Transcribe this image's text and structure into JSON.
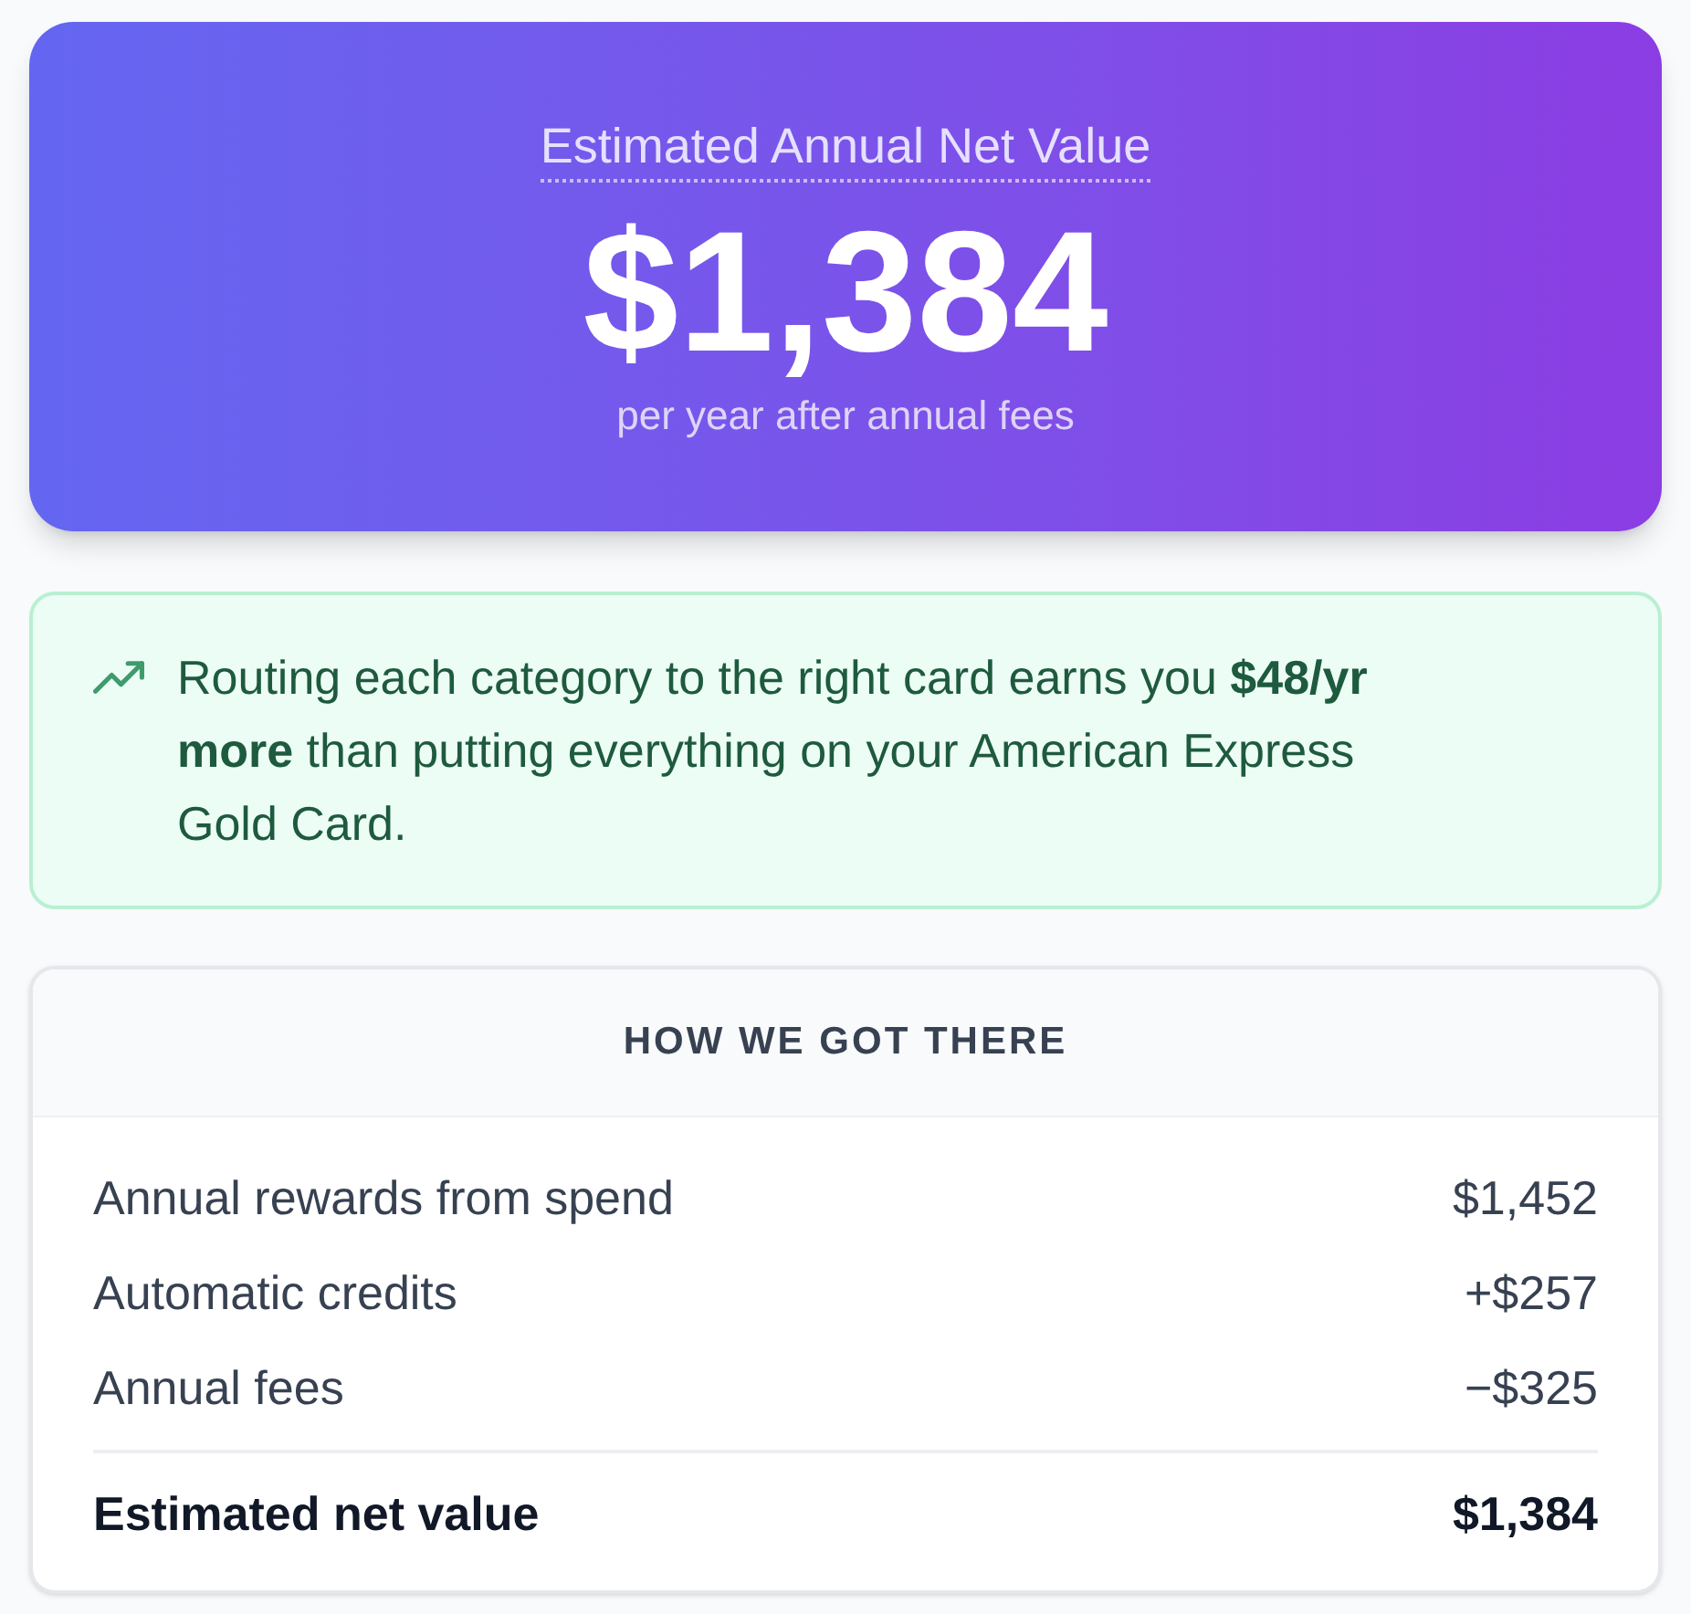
{
  "hero": {
    "title": "Estimated Annual Net Value",
    "value": "$1,384",
    "caption": "per year after annual fees"
  },
  "callout": {
    "text": "Routing each category to the right card earns you **$48/yr more** than putting everything on your American Express Gold Card."
  },
  "breakdown": {
    "title": "HOW WE GOT THERE",
    "rows": [
      {
        "label": "Annual rewards from spend",
        "value": "$1,452"
      },
      {
        "label": "Automatic credits",
        "value": "+$257"
      },
      {
        "label": "Annual fees",
        "value": "−$325"
      }
    ],
    "total": {
      "label": "Estimated net value",
      "value": "$1,384"
    }
  }
}
